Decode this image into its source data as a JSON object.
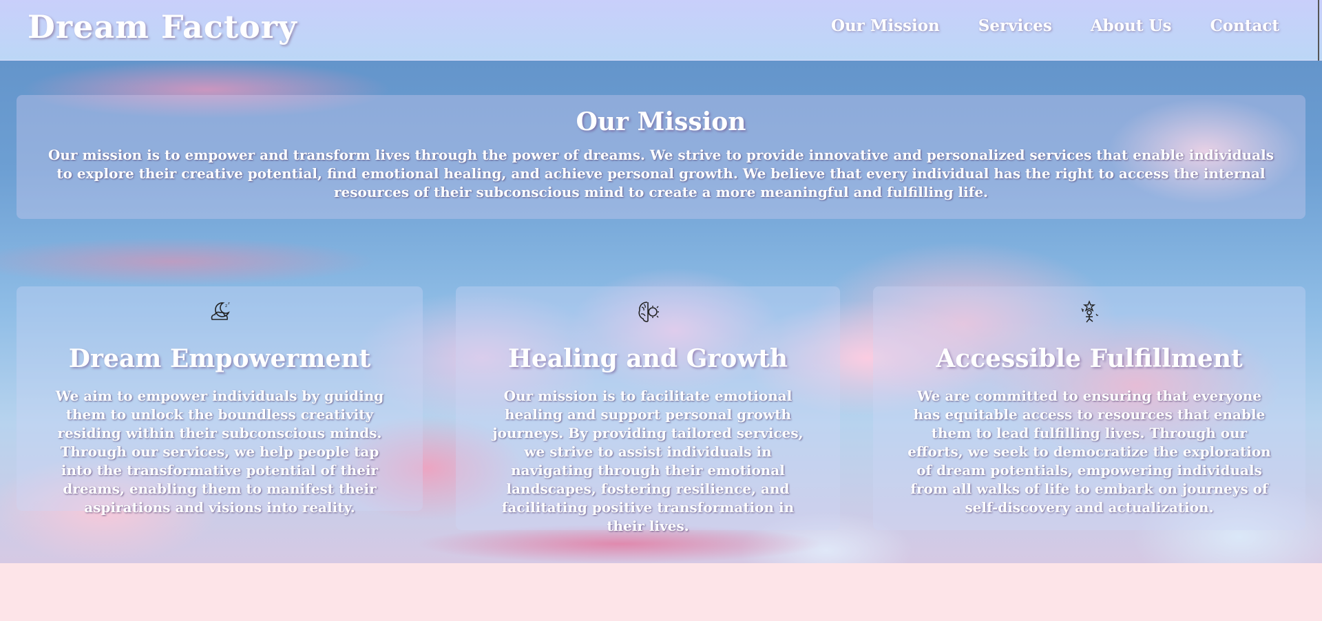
{
  "header": {
    "brand": "Dream Factory",
    "nav": [
      "Our Mission",
      "Services",
      "About Us",
      "Contact"
    ]
  },
  "mission": {
    "title": "Our Mission",
    "text": "Our mission is to empower and transform lives through the power of dreams. We strive to provide innovative and personalized services that enable individuals to explore their creative potential, find emotional healing, and achieve personal growth. We believe that every individual has the right to access the internal resources of their subconscious mind to create a more meaningful and fulfilling life."
  },
  "services": [
    {
      "icon": "moon-cloud-icon",
      "title": "Dream Empowerment",
      "text": "We aim to empower individuals by guiding them to unlock the boundless creativity residing within their subconscious minds. Through our services, we help people tap into the transformative potential of their dreams, enabling them to manifest their aspirations and visions into reality."
    },
    {
      "icon": "brain-icon",
      "title": "Healing and Growth",
      "text": "Our mission is to facilitate emotional healing and support personal growth journeys. By providing tailored services, we strive to assist individuals in navigating through their emotional landscapes, fostering resilience, and facilitating positive transformation in their lives."
    },
    {
      "icon": "fairy-icon",
      "title": "Accessible Fulfillment",
      "text": "We are committed to ensuring that everyone has equitable access to resources that enable them to lead fulfilling lives. Through our efforts, we seek to democratize the exploration of dream potentials, empowering individuals from all walks of life to embark on journeys of self-discovery and actualization."
    }
  ]
}
